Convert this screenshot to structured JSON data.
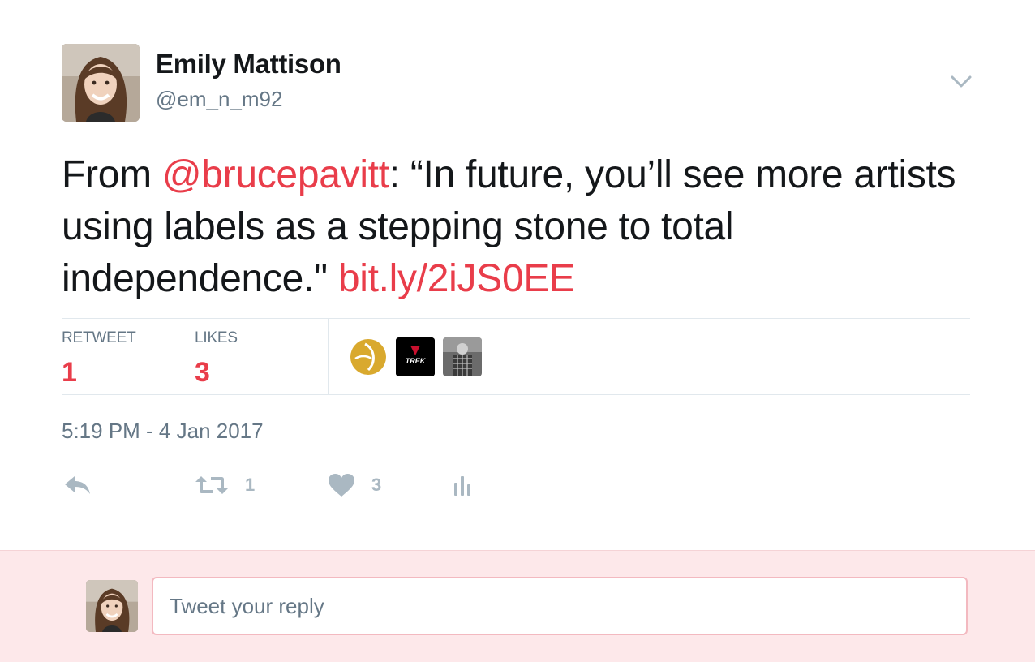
{
  "author": {
    "name": "Emily Mattison",
    "handle": "@em_n_m92"
  },
  "tweet": {
    "text_prefix": "From ",
    "mention": "@brucepavitt",
    "text_body": ": “In future, you’ll see more artists using labels as a stepping stone to total independence.\" ",
    "link": "bit.ly/2iJS0EE"
  },
  "stats": {
    "retweets_label": "RETWEET",
    "retweets_count": "1",
    "likes_label": "LIKES",
    "likes_count": "3"
  },
  "likers": [
    {
      "icon": "yellow-circle-logo"
    },
    {
      "icon": "trek-logo",
      "text": "TREK"
    },
    {
      "icon": "photo-avatar"
    }
  ],
  "timestamp": "5:19 PM - 4 Jan 2017",
  "actions": {
    "retweet_count": "1",
    "like_count": "3"
  },
  "reply": {
    "placeholder": "Tweet your reply"
  },
  "colors": {
    "accent": "#e93d4a",
    "muted": "#657786",
    "icon": "#aab8c2",
    "reply_bg": "#fde8ea"
  }
}
